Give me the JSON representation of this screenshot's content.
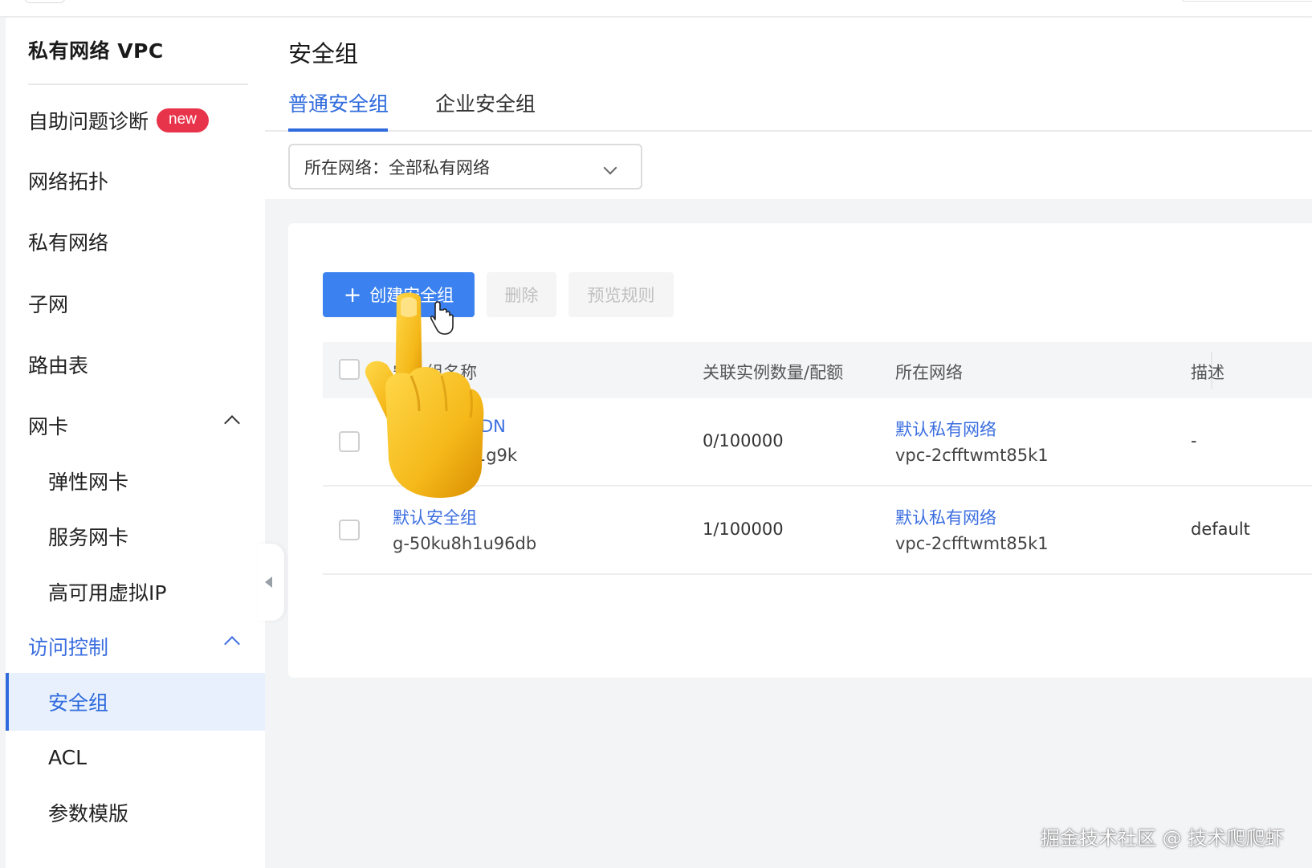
{
  "sidebar": {
    "title": "私有网络 VPC",
    "items": [
      {
        "label": "自助问题诊断",
        "badge": "new"
      },
      {
        "label": "网络拓扑"
      },
      {
        "label": "私有网络"
      },
      {
        "label": "子网"
      },
      {
        "label": "路由表"
      },
      {
        "label": "网卡"
      },
      {
        "label": "弹性网卡"
      },
      {
        "label": "服务网卡"
      },
      {
        "label": "高可用虚拟IP"
      },
      {
        "label": "访问控制"
      },
      {
        "label": "安全组"
      },
      {
        "label": "ACL"
      },
      {
        "label": "参数模版"
      }
    ]
  },
  "header": {
    "title": "安全组",
    "tabs": [
      {
        "label": "普通安全组",
        "active": true
      },
      {
        "label": "企业安全组",
        "active": false
      }
    ],
    "network_filter": "所在网络：全部私有网络"
  },
  "toolbar": {
    "create_label": "创建安全组",
    "delete_label": "删除",
    "preview_label": "预览规则"
  },
  "table": {
    "columns": [
      "安全组名称",
      "关联实例数量/配额",
      "所在网络",
      "描述"
    ],
    "rows": [
      {
        "name": "DN",
        "id_start": "g-",
        "id_end": "o1g9k",
        "quota": "0/100000",
        "network_name": "默认私有网络",
        "network_id": "vpc-2cfftwmt85k1",
        "desc": "-"
      },
      {
        "name": "默认安全组",
        "id": "g-50ku8h1u96db",
        "quota": "1/100000",
        "network_name": "默认私有网络",
        "network_id": "vpc-2cfftwmt85k1",
        "desc": "default"
      }
    ]
  },
  "watermark": "掘金技术社区 @ 技术爬爬虾",
  "colors": {
    "accent": "#2f6bdd",
    "primary_button": "#3b82f0",
    "badge": "#e8344a",
    "selected_bg": "#e9f0fd"
  },
  "icons": [
    "chevron-up-icon",
    "chevron-down-icon",
    "plus-icon",
    "collapse-arrow-icon",
    "pointing-hand-icon",
    "cursor-hand-icon"
  ]
}
